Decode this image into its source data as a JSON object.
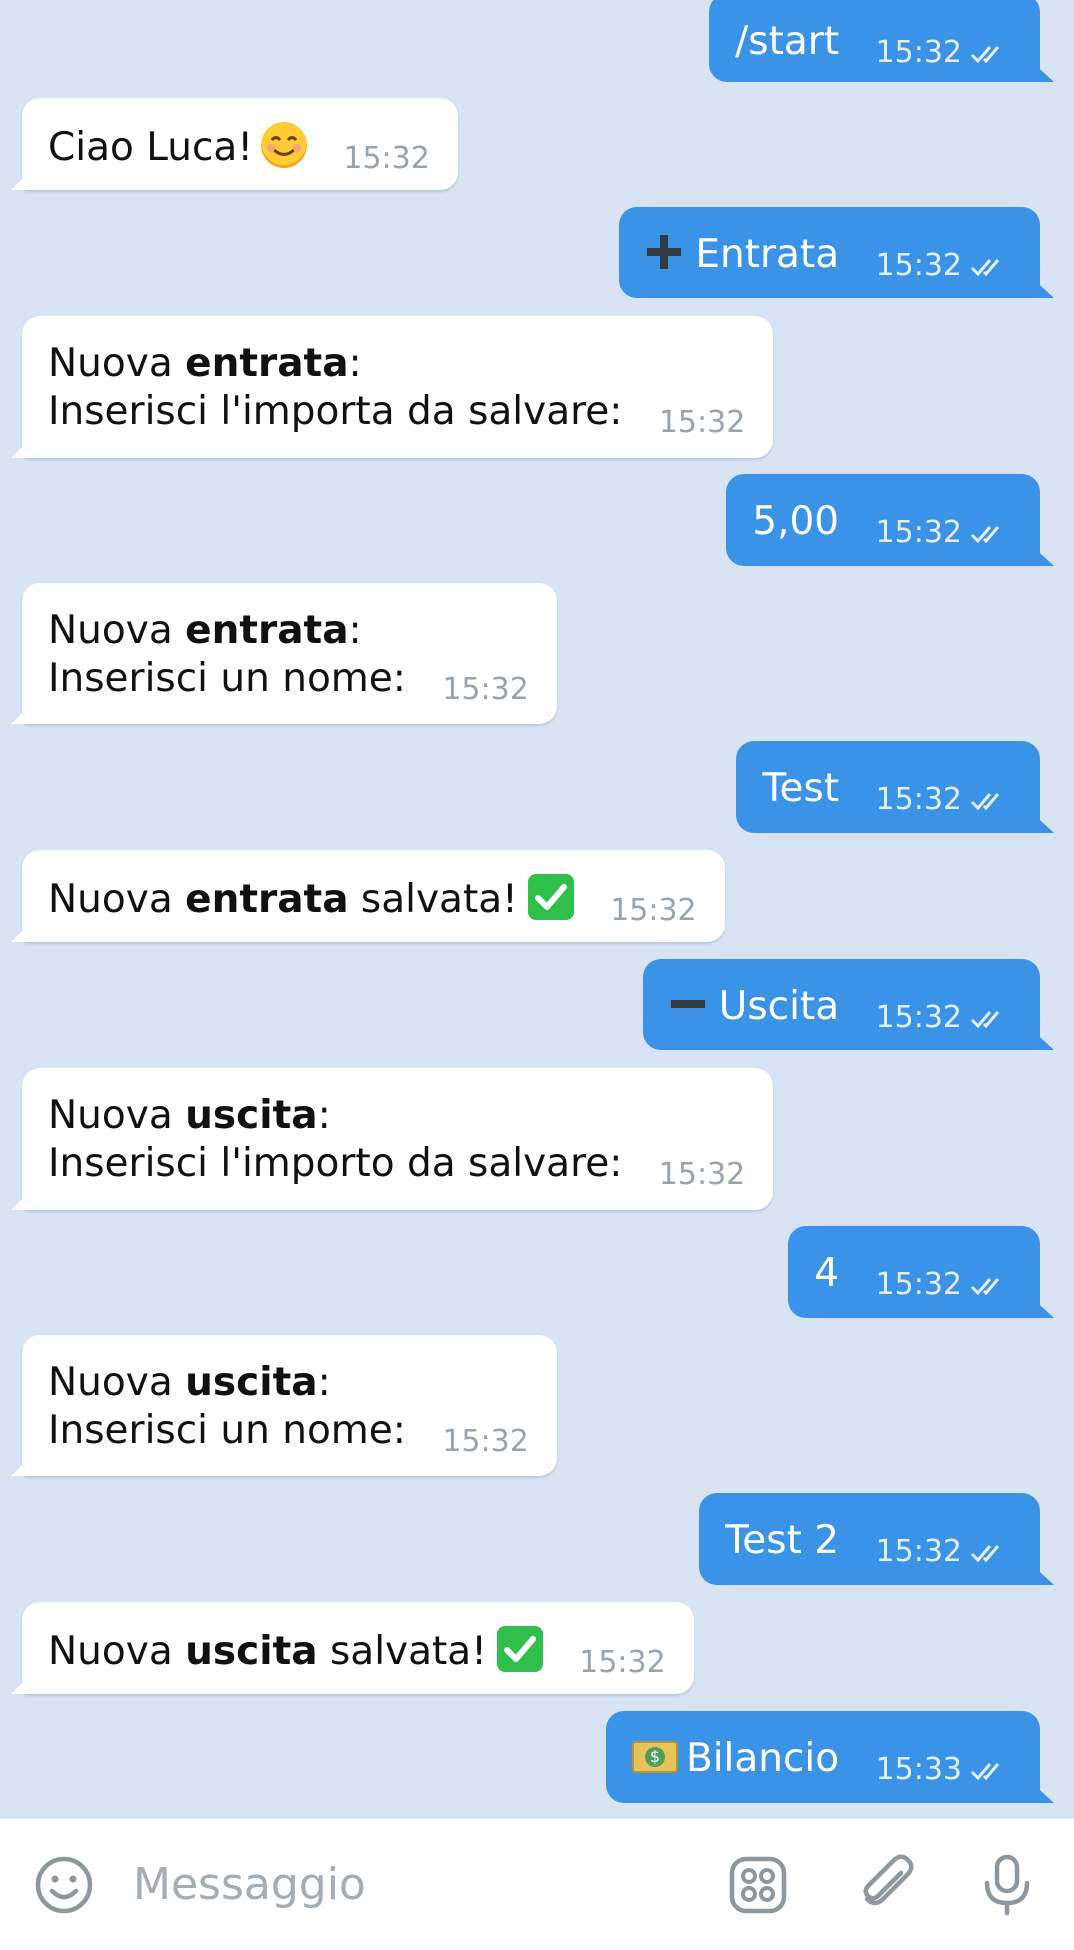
{
  "messages": [
    {
      "dir": "out",
      "text": "/start",
      "time": "15:32"
    },
    {
      "dir": "in",
      "text": "Ciao Luca!",
      "emoji": "smiling-face-icon",
      "time": "15:32"
    },
    {
      "dir": "out",
      "icon": "plus-icon",
      "text": "Entrata",
      "time": "15:32"
    },
    {
      "dir": "in",
      "line1_pre": "Nuova ",
      "line1_bold": "entrata",
      "line1_post": ":",
      "line2": "Inserisci l'importa da salvare:",
      "time": "15:32"
    },
    {
      "dir": "out",
      "text": "5,00",
      "time": "15:32"
    },
    {
      "dir": "in",
      "line1_pre": "Nuova ",
      "line1_bold": "entrata",
      "line1_post": ":",
      "line2": "Inserisci un nome:",
      "time": "15:32"
    },
    {
      "dir": "out",
      "text": "Test",
      "time": "15:32"
    },
    {
      "dir": "in",
      "pre": "Nuova ",
      "bold": "entrata",
      "post": " salvata!",
      "emoji": "check-mark-icon",
      "time": "15:32"
    },
    {
      "dir": "out",
      "icon": "minus-icon",
      "text": "Uscita",
      "time": "15:32"
    },
    {
      "dir": "in",
      "line1_pre": "Nuova ",
      "line1_bold": "uscita",
      "line1_post": ":",
      "line2": "Inserisci l'importo da salvare:",
      "time": "15:32"
    },
    {
      "dir": "out",
      "text": "4",
      "time": "15:32"
    },
    {
      "dir": "in",
      "line1_pre": "Nuova ",
      "line1_bold": "uscita",
      "line1_post": ":",
      "line2": "Inserisci un nome:",
      "time": "15:32"
    },
    {
      "dir": "out",
      "text": "Test 2",
      "time": "15:32"
    },
    {
      "dir": "in",
      "pre": "Nuova ",
      "bold": "uscita",
      "post": " salvata!",
      "emoji": "check-mark-icon",
      "time": "15:32"
    },
    {
      "dir": "out",
      "icon": "money-icon",
      "text": "Bilancio",
      "time": "15:33"
    }
  ],
  "composer": {
    "placeholder": "Messaggio",
    "icons": [
      "emoji-icon",
      "stickers-icon",
      "attach-icon",
      "microphone-icon"
    ]
  },
  "colors": {
    "background": "#d8e4f3",
    "outgoing_bubble": "#3a93e6",
    "incoming_bubble": "#ffffff",
    "timestamp_in": "#9aa3ad"
  }
}
